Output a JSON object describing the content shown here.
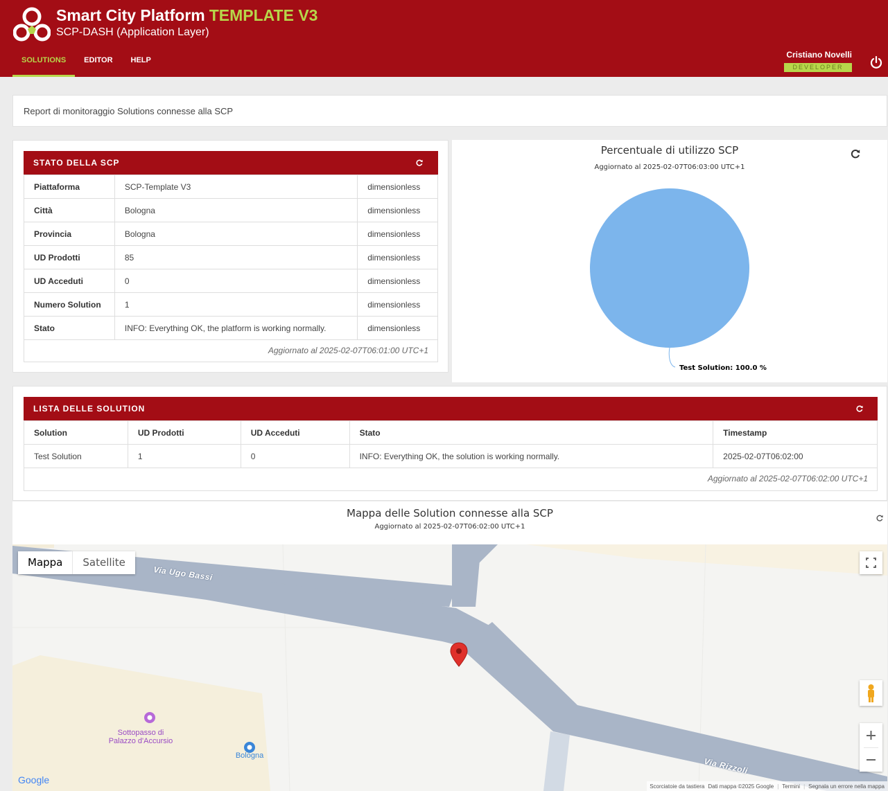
{
  "header": {
    "title": "Smart City Platform",
    "title_accent": "TEMPLATE V3",
    "subtitle": "SCP-DASH (Application Layer)",
    "nav": [
      {
        "label": "SOLUTIONS",
        "active": true
      },
      {
        "label": "EDITOR",
        "active": false
      },
      {
        "label": "HELP",
        "active": false
      }
    ],
    "user_name": "Cristiano Novelli",
    "user_role": "DEVELOPER",
    "power_icon": "power-icon",
    "colors": {
      "brand": "#a30d15",
      "accent": "#b7d64a"
    }
  },
  "info_bar": {
    "text": "Report di monitoraggio Solutions connesse alla SCP"
  },
  "stato_scp": {
    "title": "STATO DELLA SCP",
    "rows": [
      {
        "label": "Piattaforma",
        "value": "SCP-Template V3",
        "unit": "dimensionless"
      },
      {
        "label": "Città",
        "value": "Bologna",
        "unit": "dimensionless"
      },
      {
        "label": "Provincia",
        "value": "Bologna",
        "unit": "dimensionless"
      },
      {
        "label": "UD Prodotti",
        "value": "85",
        "unit": "dimensionless"
      },
      {
        "label": "UD Acceduti",
        "value": "0",
        "unit": "dimensionless"
      },
      {
        "label": "Numero Solution",
        "value": "1",
        "unit": "dimensionless"
      },
      {
        "label": "Stato",
        "value": "INFO: Everything OK, the platform is working normally.",
        "unit": "dimensionless"
      }
    ],
    "footer": "Aggiornato al 2025-02-07T06:01:00 UTC+1"
  },
  "pie": {
    "title": "Percentuale di utilizzo SCP",
    "subtitle": "Aggiornato al 2025-02-07T06:03:00 UTC+1",
    "slice_label": "Test Solution: 100.0 %",
    "color": "#7cb5ec"
  },
  "chart_data": {
    "type": "pie",
    "title": "Percentuale di utilizzo SCP",
    "subtitle": "Aggiornato al 2025-02-07T06:03:00 UTC+1",
    "categories": [
      "Test Solution"
    ],
    "values": [
      100.0
    ],
    "data_labels": [
      "Test Solution: 100.0 %"
    ]
  },
  "lista_solution": {
    "title": "LISTA DELLE SOLUTION",
    "columns": [
      "Solution",
      "UD Prodotti",
      "UD Acceduti",
      "Stato",
      "Timestamp"
    ],
    "rows": [
      [
        "Test Solution",
        "1",
        "0",
        "INFO: Everything OK, the solution is working normally.",
        "2025-02-07T06:02:00"
      ]
    ],
    "footer": "Aggiornato al 2025-02-07T06:02:00 UTC+1"
  },
  "map": {
    "title": "Mappa delle Solution connesse alla SCP",
    "subtitle": "Aggiornato al 2025-02-07T06:02:00 UTC+1",
    "type_buttons": [
      "Mappa",
      "Satellite"
    ],
    "streets": {
      "ugo_bassi": "Via Ugo Bassi",
      "rizzoli": "Via Rizzoli"
    },
    "poi": {
      "sottopasso": "Sottopasso di\nPalazzo d'Accursio",
      "bologna": "Bologna"
    },
    "google": "Google",
    "footer_links": [
      "Scorciatoie da tastiera",
      "Dati mappa ©2025 Google",
      "Termini",
      "Segnala un errore nella mappa"
    ]
  }
}
